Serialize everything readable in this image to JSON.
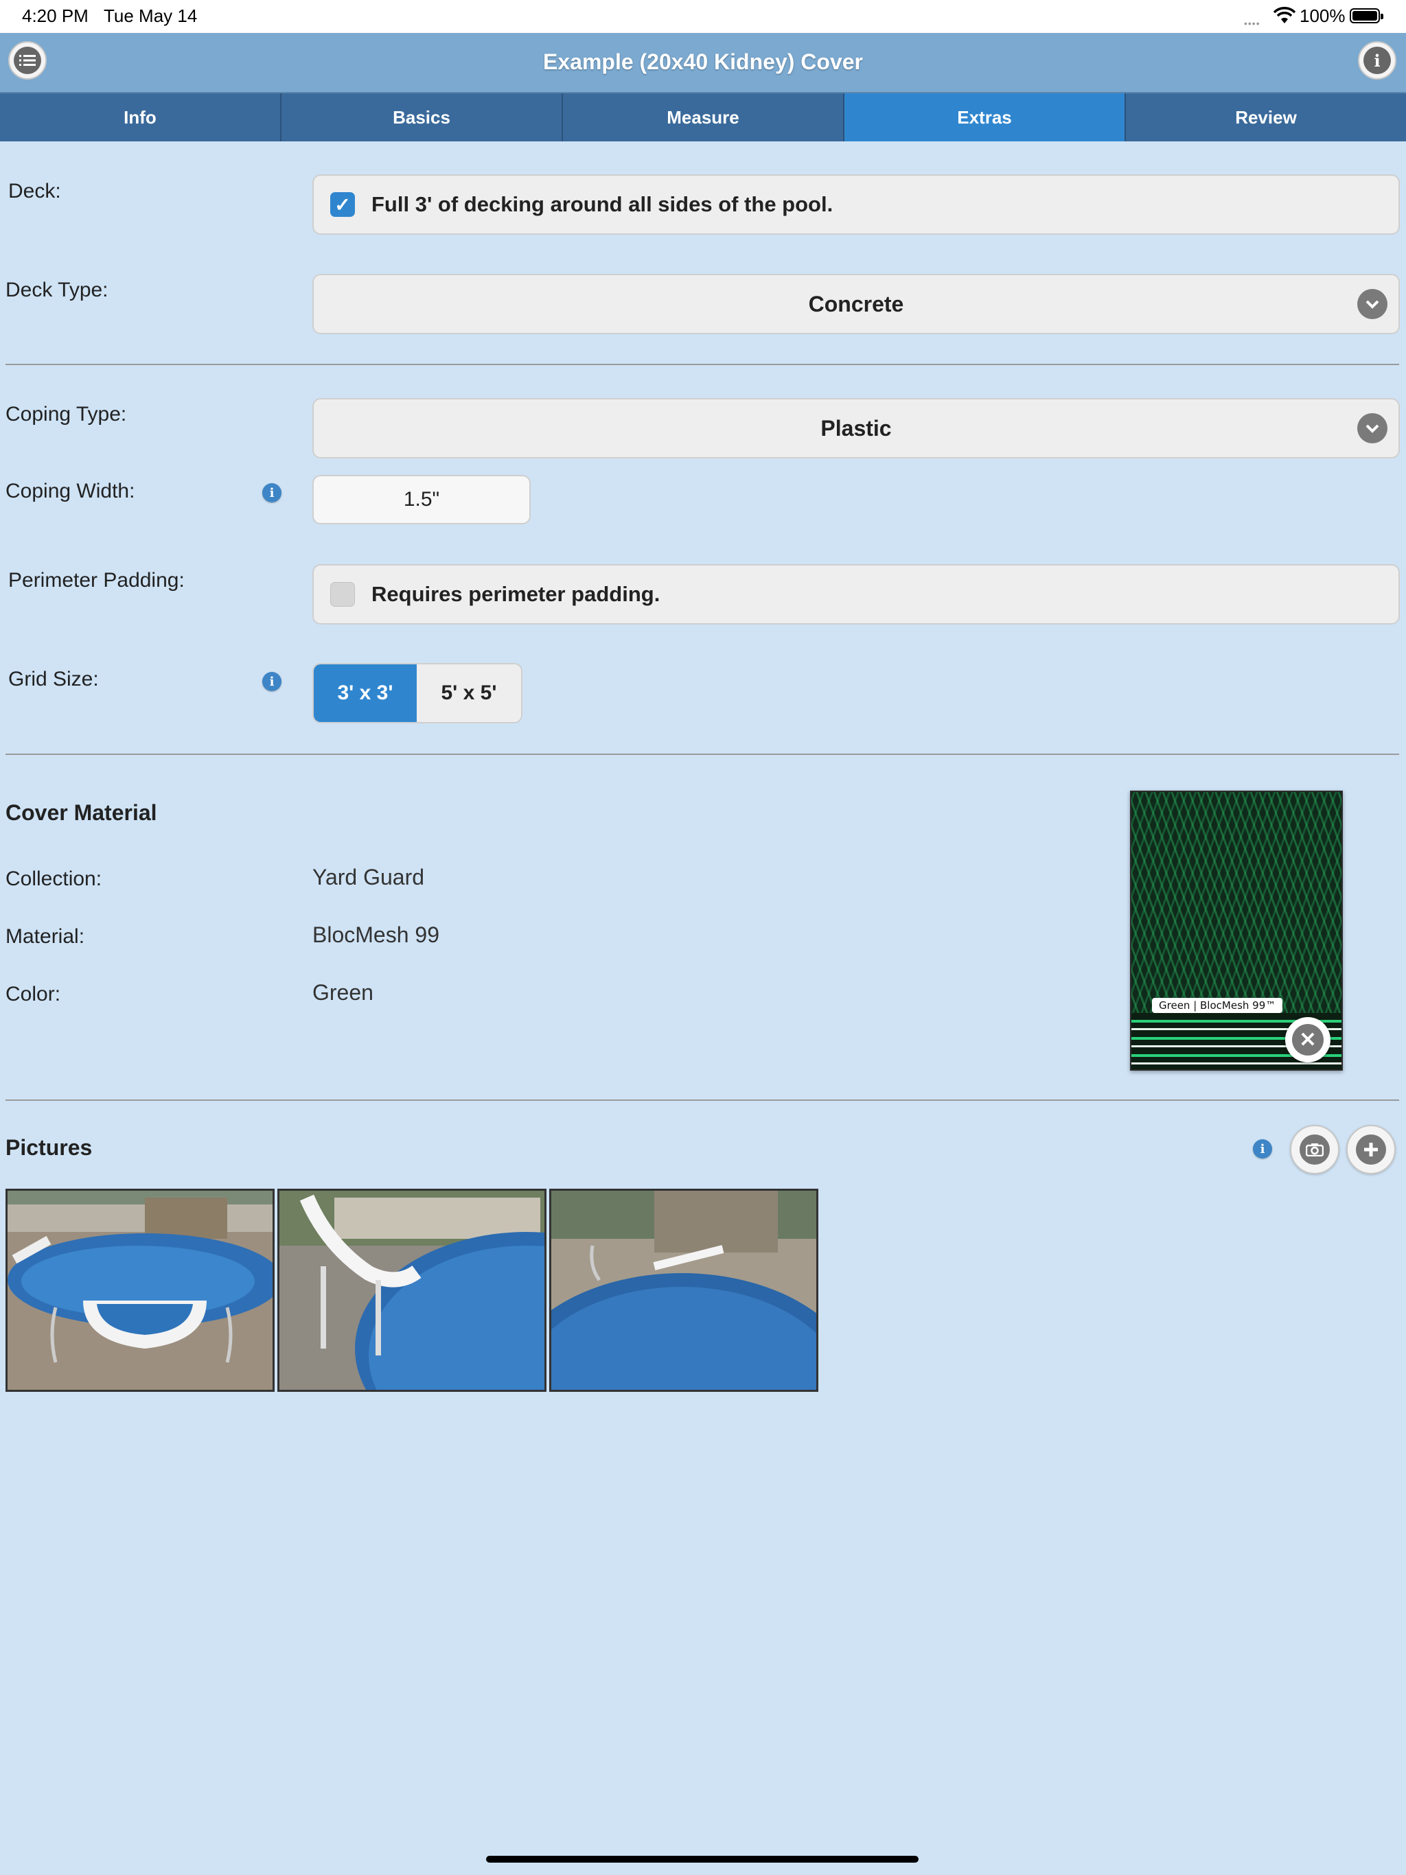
{
  "status_bar": {
    "time": "4:20 PM",
    "date": "Tue May 14",
    "battery": "100%"
  },
  "header": {
    "title": "Example (20x40 Kidney) Cover",
    "menu_icon": "list-icon",
    "info_icon": "info-icon"
  },
  "tabs": [
    {
      "label": "Info",
      "active": false
    },
    {
      "label": "Basics",
      "active": false
    },
    {
      "label": "Measure",
      "active": false
    },
    {
      "label": "Extras",
      "active": true
    },
    {
      "label": "Review",
      "active": false
    }
  ],
  "deck": {
    "label": "Deck:",
    "checkbox_text": "Full 3' of decking around all sides of the pool.",
    "checked": true
  },
  "deck_type": {
    "label": "Deck Type:",
    "value": "Concrete"
  },
  "coping_type": {
    "label": "Coping Type:",
    "value": "Plastic"
  },
  "coping_width": {
    "label": "Coping Width:",
    "value": "1.5\""
  },
  "perimeter_padding": {
    "label": "Perimeter Padding:",
    "checkbox_text": "Requires perimeter padding.",
    "checked": false
  },
  "grid_size": {
    "label": "Grid Size:",
    "options": [
      "3' x 3'",
      "5' x 5'"
    ],
    "selected": "3' x 3'"
  },
  "cover_material": {
    "heading": "Cover Material",
    "collection_label": "Collection:",
    "collection": "Yard Guard",
    "material_label": "Material:",
    "material": "BlocMesh 99",
    "color_label": "Color:",
    "color": "Green",
    "swatch_label": "Green | BlocMesh 99™",
    "swatch_color": "#0f2a1a"
  },
  "pictures": {
    "heading": "Pictures",
    "count": 3
  },
  "colors": {
    "background": "#cfe3f5",
    "header": "#7ba9d0",
    "tab": "#3a6a9b",
    "tab_active": "#2f86cf",
    "accent": "#2f86cf"
  }
}
